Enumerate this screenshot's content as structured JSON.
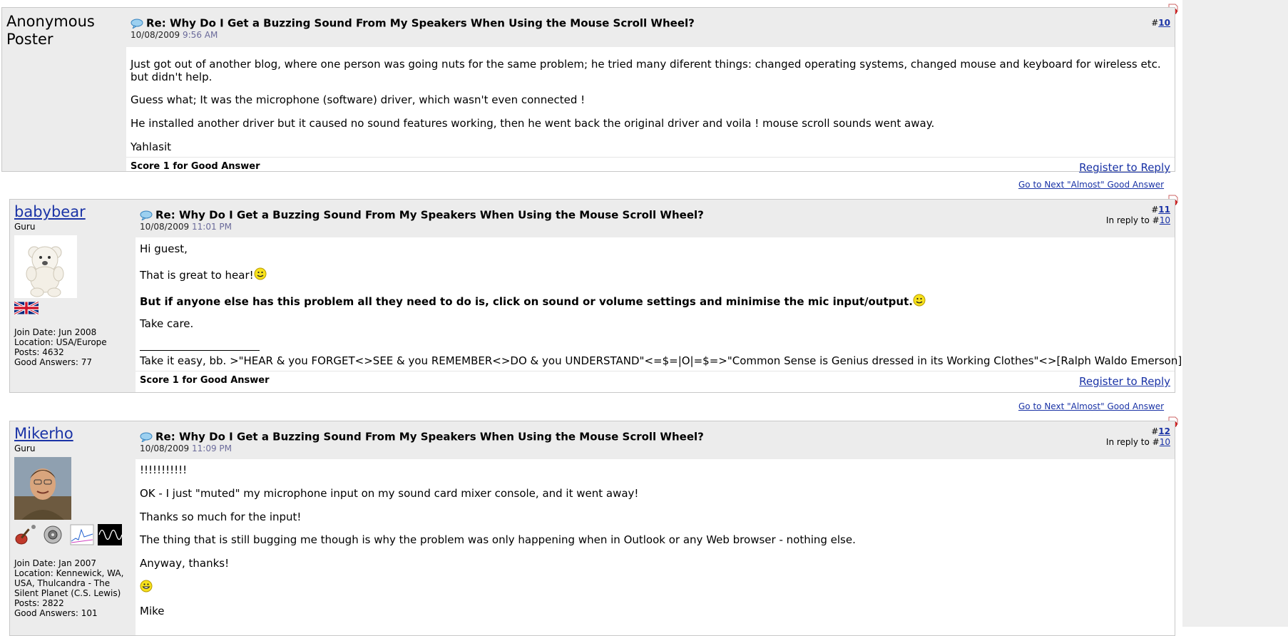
{
  "posts": [
    {
      "author": "Anonymous Poster",
      "title": "Re: Why Do I Get a Buzzing Sound From My Speakers When Using the Mouse Scroll Wheel?",
      "date": "10/08/2009",
      "time": "9:56 AM",
      "post_number_prefix": "#",
      "post_number": "10",
      "paragraphs": [
        "Just got out of another blog, where one person was going nuts for the same problem; he tried many diferent things: changed operating systems, changed mouse and keyboard for wireless etc. but didn't help.",
        "Guess what; It was the microphone (software) driver, which wasn't even connected !",
        "He installed another driver but it caused no sound features working, then he went back the original driver and voila ! mouse scroll sounds went away.",
        "Yahlasit"
      ],
      "score": "Score 1 for Good Answer",
      "reply_label": "Register to Reply",
      "next_label": "Go to Next \"Almost\" Good Answer"
    },
    {
      "author": "babybear",
      "rank": "Guru",
      "stats": {
        "join": "Join Date: Jun 2008",
        "location": "Location: USA/Europe",
        "posts": "Posts: 4632",
        "good_answers": "Good Answers: 77"
      },
      "title": "Re: Why Do I Get a Buzzing Sound From My Speakers When Using the Mouse Scroll Wheel?",
      "date": "10/08/2009",
      "time": "11:01 PM",
      "post_number_prefix": "#",
      "post_number": "11",
      "in_reply_prefix": "In reply to #",
      "in_reply_to": "10",
      "paragraphs": [
        "Hi guest,",
        "That is great to hear!",
        "But if anyone else has this problem all they need to do is, click on sound or volume settings and minimise the mic input/output.",
        "Take care."
      ],
      "signature": "Take it easy, bb. >\"HEAR & you FORGET<>SEE & you REMEMBER<>DO & you UNDERSTAND\"<=$=|O|=$=>\"Common Sense is Genius dressed in its Working Clothes\"<>[Ralph Waldo Emerson]",
      "score": "Score 1 for Good Answer",
      "reply_label": "Register to Reply",
      "next_label": "Go to Next \"Almost\" Good Answer"
    },
    {
      "author": "Mikerho",
      "rank": "Guru",
      "stats": {
        "join": "Join Date: Jan 2007",
        "location": "Location: Kennewick, WA, USA, Thulcandra - The Silent Planet (C.S. Lewis)",
        "posts": "Posts: 2822",
        "good_answers": "Good Answers: 101"
      },
      "title": "Re: Why Do I Get a Buzzing Sound From My Speakers When Using the Mouse Scroll Wheel?",
      "date": "10/08/2009",
      "time": "11:09 PM",
      "post_number_prefix": "#",
      "post_number": "12",
      "in_reply_prefix": "In reply to #",
      "in_reply_to": "10",
      "paragraphs": [
        "!!!!!!!!!!!",
        "OK - I just \"muted\" my microphone input on my sound card mixer console, and it went away!",
        "Thanks so much for the input!",
        "The thing that is still bugging me though is why the problem was only happening when in Outlook or any Web browser - nothing else.",
        "Anyway, thanks!",
        "Mike"
      ]
    }
  ],
  "colors": {
    "link": "#1a33a6",
    "header_bg": "#ececec",
    "time": "#6a6a9a"
  }
}
